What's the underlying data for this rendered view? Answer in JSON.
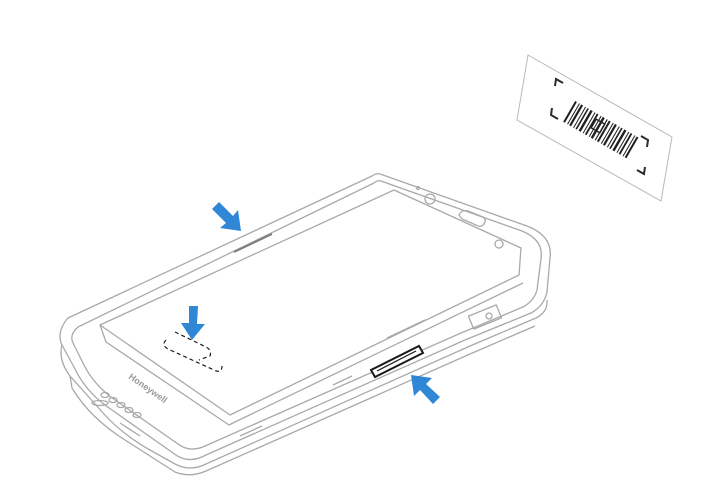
{
  "device": {
    "brand_label": "Honeywell"
  },
  "colors": {
    "arrow": "#2f87d6",
    "outline": "#a9a9a9",
    "highlight_outline": "#1b1b1b",
    "background": "#ffffff"
  },
  "icons": {
    "arrows": [
      "arrow-icon",
      "arrow-icon",
      "arrow-icon"
    ],
    "barcode": "barcode-label"
  }
}
